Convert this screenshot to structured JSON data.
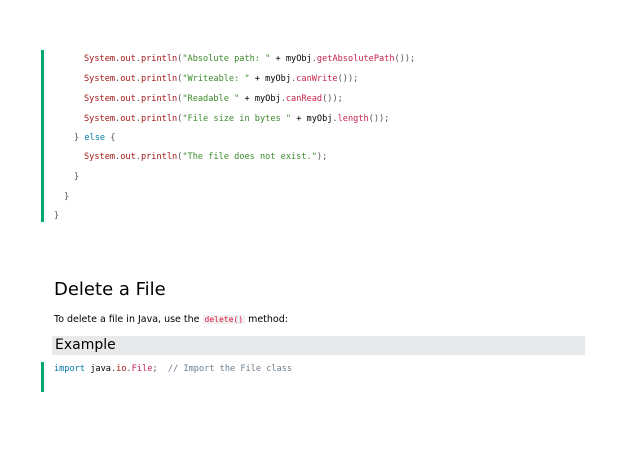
{
  "code_block_1": {
    "lines": [
      {
        "tokens": [
          [
            "class",
            "System"
          ],
          [
            "punc",
            "."
          ],
          [
            "member",
            "out"
          ],
          [
            "punc",
            "."
          ],
          [
            "member",
            "println"
          ],
          [
            "punc",
            "("
          ],
          [
            "string",
            "\"Absolute path: \""
          ],
          [
            "plain",
            " + "
          ],
          [
            "var",
            "myObj"
          ],
          [
            "punc",
            "."
          ],
          [
            "fn",
            "getAbsolutePath"
          ],
          [
            "punc",
            "());"
          ]
        ]
      },
      {
        "tokens": [
          [
            "class",
            "System"
          ],
          [
            "punc",
            "."
          ],
          [
            "member",
            "out"
          ],
          [
            "punc",
            "."
          ],
          [
            "member",
            "println"
          ],
          [
            "punc",
            "("
          ],
          [
            "string",
            "\"Writeable: \""
          ],
          [
            "plain",
            " + "
          ],
          [
            "var",
            "myObj"
          ],
          [
            "punc",
            "."
          ],
          [
            "fn",
            "canWrite"
          ],
          [
            "punc",
            "());"
          ]
        ]
      },
      {
        "tokens": [
          [
            "class",
            "System"
          ],
          [
            "punc",
            "."
          ],
          [
            "member",
            "out"
          ],
          [
            "punc",
            "."
          ],
          [
            "member",
            "println"
          ],
          [
            "punc",
            "("
          ],
          [
            "string",
            "\"Readable \""
          ],
          [
            "plain",
            " + "
          ],
          [
            "var",
            "myObj"
          ],
          [
            "punc",
            "."
          ],
          [
            "fn",
            "canRead"
          ],
          [
            "punc",
            "());"
          ]
        ]
      },
      {
        "tokens": [
          [
            "class",
            "System"
          ],
          [
            "punc",
            "."
          ],
          [
            "member",
            "out"
          ],
          [
            "punc",
            "."
          ],
          [
            "member",
            "println"
          ],
          [
            "punc",
            "("
          ],
          [
            "string",
            "\"File size in bytes \""
          ],
          [
            "plain",
            " + "
          ],
          [
            "var",
            "myObj"
          ],
          [
            "punc",
            "."
          ],
          [
            "fn",
            "length"
          ],
          [
            "punc",
            "());"
          ]
        ]
      },
      {
        "tokens": [
          [
            "punc",
            "} "
          ],
          [
            "keyword",
            "else"
          ],
          [
            "punc",
            " {"
          ]
        ]
      },
      {
        "tokens": [
          [
            "class",
            "System"
          ],
          [
            "punc",
            "."
          ],
          [
            "member",
            "out"
          ],
          [
            "punc",
            "."
          ],
          [
            "member",
            "println"
          ],
          [
            "punc",
            "("
          ],
          [
            "string",
            "\"The file does not exist.\""
          ],
          [
            "punc",
            ");"
          ]
        ]
      },
      {
        "tokens": [
          [
            "punc",
            "}"
          ]
        ]
      },
      {
        "tokens": [
          [
            "punc",
            "}"
          ]
        ]
      },
      {
        "tokens": [
          [
            "punc",
            "}"
          ]
        ]
      }
    ]
  },
  "section": {
    "title": "Delete a File",
    "intro_before": "To delete a file in Java, use the ",
    "intro_code": "delete()",
    "intro_after": " method:"
  },
  "example": {
    "title": "Example"
  },
  "code_block_2": {
    "lines": [
      {
        "tokens": [
          [
            "keyword",
            "import"
          ],
          [
            "plain",
            " "
          ],
          [
            "var",
            "java"
          ],
          [
            "punc",
            "."
          ],
          [
            "member",
            "io"
          ],
          [
            "punc",
            "."
          ],
          [
            "fn",
            "File"
          ],
          [
            "punc",
            ";"
          ],
          [
            "plain",
            "  "
          ],
          [
            "comment",
            "// Import the File class"
          ]
        ]
      }
    ]
  },
  "colors": {
    "accent_border": "#04aa6d",
    "example_bar": "#e7e9eb"
  }
}
